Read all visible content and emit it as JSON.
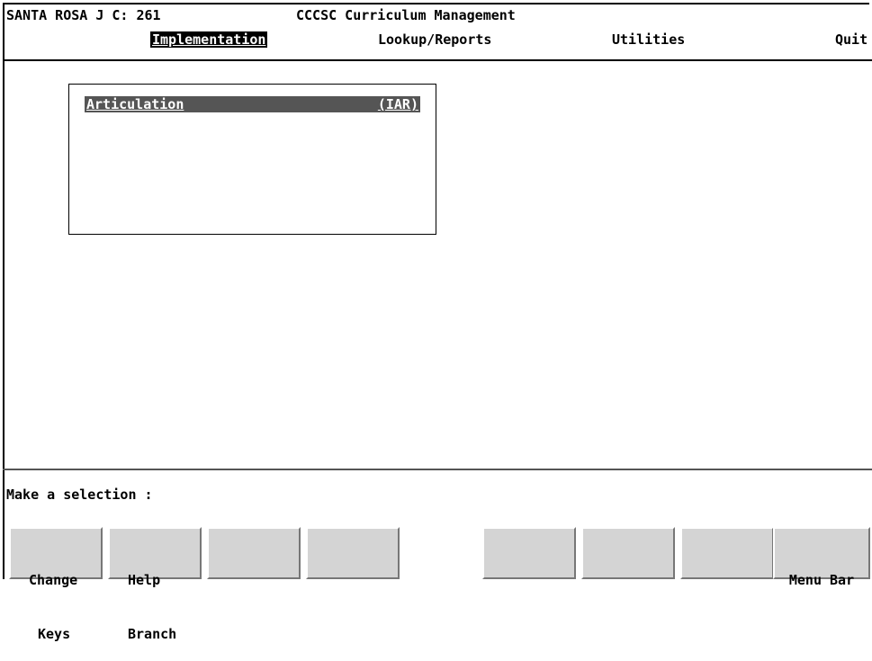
{
  "header": {
    "site": "SANTA ROSA J C: 261",
    "title": "CCCSC Curriculum Management"
  },
  "menu": {
    "items": [
      {
        "label": "Implementation",
        "active": true
      },
      {
        "label": "Lookup/Reports",
        "active": false
      },
      {
        "label": "Utilities",
        "active": false
      },
      {
        "label": "Quit",
        "active": false
      }
    ]
  },
  "submenu": {
    "items": [
      {
        "label": "Articulation",
        "code": "(IAR)"
      }
    ]
  },
  "prompt": "Make a selection :",
  "function_keys": [
    {
      "line1": "Change",
      "line2": "Keys"
    },
    {
      "line1": "Help",
      "line2": "Branch"
    },
    {
      "line1": "",
      "line2": ""
    },
    {
      "line1": "",
      "line2": ""
    },
    {
      "line1": "",
      "line2": ""
    },
    {
      "line1": "",
      "line2": ""
    },
    {
      "line1": "",
      "line2": ""
    },
    {
      "line1": "Menu Bar",
      "line2": ""
    }
  ]
}
